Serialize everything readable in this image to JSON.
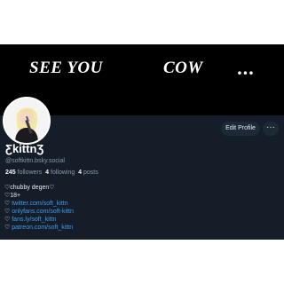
{
  "banner": {
    "words": [
      "SEE YOU",
      "COW",
      "..."
    ]
  },
  "profile": {
    "display_name": "ƸkittnƷ",
    "handle": "@softkittn.bsky.social",
    "stats": {
      "followers_count": "245",
      "followers_label": "followers",
      "following_count": "4",
      "following_label": "following",
      "posts_count": "4",
      "posts_label": "posts"
    },
    "edit_button_label": "Edit Profile",
    "more_button_label": "···",
    "bio": {
      "line1": "♡chubby degen♡",
      "line2": "♡18+",
      "links": [
        {
          "prefix": "♡",
          "text": "twitter.com/soft_kittn"
        },
        {
          "prefix": "♡",
          "text": "onlyfans.com/soft-kittn"
        },
        {
          "prefix": "♡",
          "text": "fans.ly/soft_kittn"
        },
        {
          "prefix": "♡",
          "text": "patreon.com/soft_kittn"
        }
      ]
    }
  },
  "colors": {
    "page_background": "#ffffff",
    "profile_background": "#151d28",
    "banner_background": "#000000",
    "link": "#3e9bf2",
    "muted_text": "#8b98a8",
    "button_background": "#1e2937"
  }
}
